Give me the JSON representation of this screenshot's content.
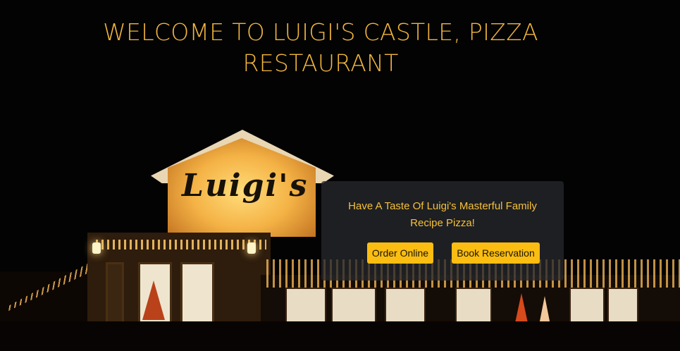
{
  "hero": {
    "title": "WELCOME TO LUIGI'S CASTLE, PIZZA RESTAURANT",
    "sign_text": "Luigi's"
  },
  "card": {
    "tagline": "Have A Taste Of Luigi's Masterful Family Recipe Pizza!",
    "order_label": "Order Online",
    "book_label": "Book Reservation"
  },
  "colors": {
    "accent": "#f2b63c",
    "button": "#fbbd12",
    "card_bg": "#26282c"
  }
}
